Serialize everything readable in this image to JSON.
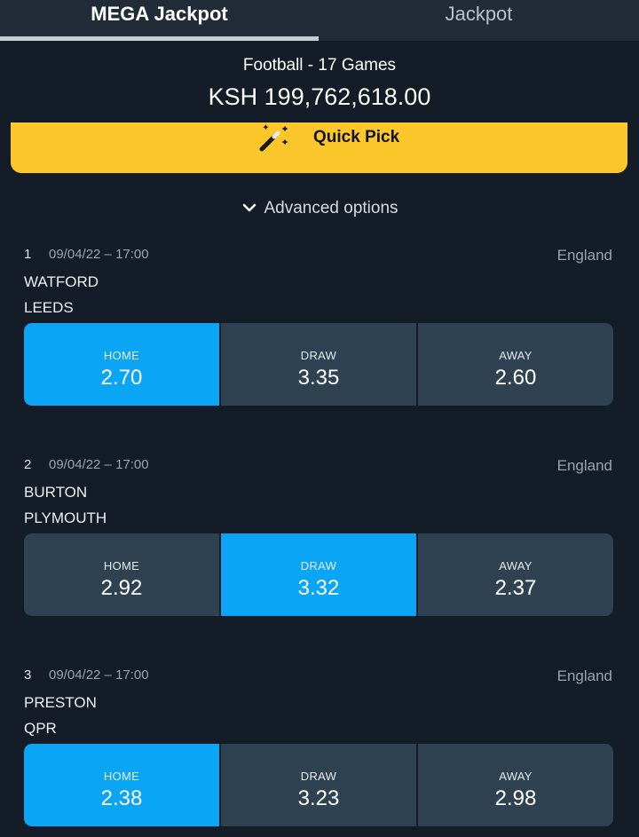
{
  "tabs": {
    "mega": "MEGA Jackpot",
    "jackpot": "Jackpot"
  },
  "header": {
    "subtitle": "Football - 17 Games",
    "amount": "KSH 199,762,618.00"
  },
  "quick_pick": {
    "label": "Quick Pick",
    "icon": "magic-wand-icon"
  },
  "advanced": {
    "label": "Advanced options",
    "icon": "chevron-down-icon"
  },
  "odds_labels": {
    "home": "HOME",
    "draw": "DRAW",
    "away": "AWAY"
  },
  "matches": [
    {
      "number": "1",
      "datetime": "09/04/22 – 17:00",
      "country": "England",
      "home_team": "WATFORD",
      "away_team": "LEEDS",
      "odds": {
        "home": "2.70",
        "draw": "3.35",
        "away": "2.60"
      },
      "selected": "home"
    },
    {
      "number": "2",
      "datetime": "09/04/22 – 17:00",
      "country": "England",
      "home_team": "BURTON",
      "away_team": "PLYMOUTH",
      "odds": {
        "home": "2.92",
        "draw": "3.32",
        "away": "2.37"
      },
      "selected": "draw"
    },
    {
      "number": "3",
      "datetime": "09/04/22 – 17:00",
      "country": "England",
      "home_team": "PRESTON",
      "away_team": "QPR",
      "odds": {
        "home": "2.38",
        "draw": "3.23",
        "away": "2.98"
      },
      "selected": "home"
    }
  ],
  "colors": {
    "background": "#131c27",
    "selected": "#0aa5f5",
    "odd_box": "#2f4251",
    "quick_pick": "#fcc72b"
  }
}
